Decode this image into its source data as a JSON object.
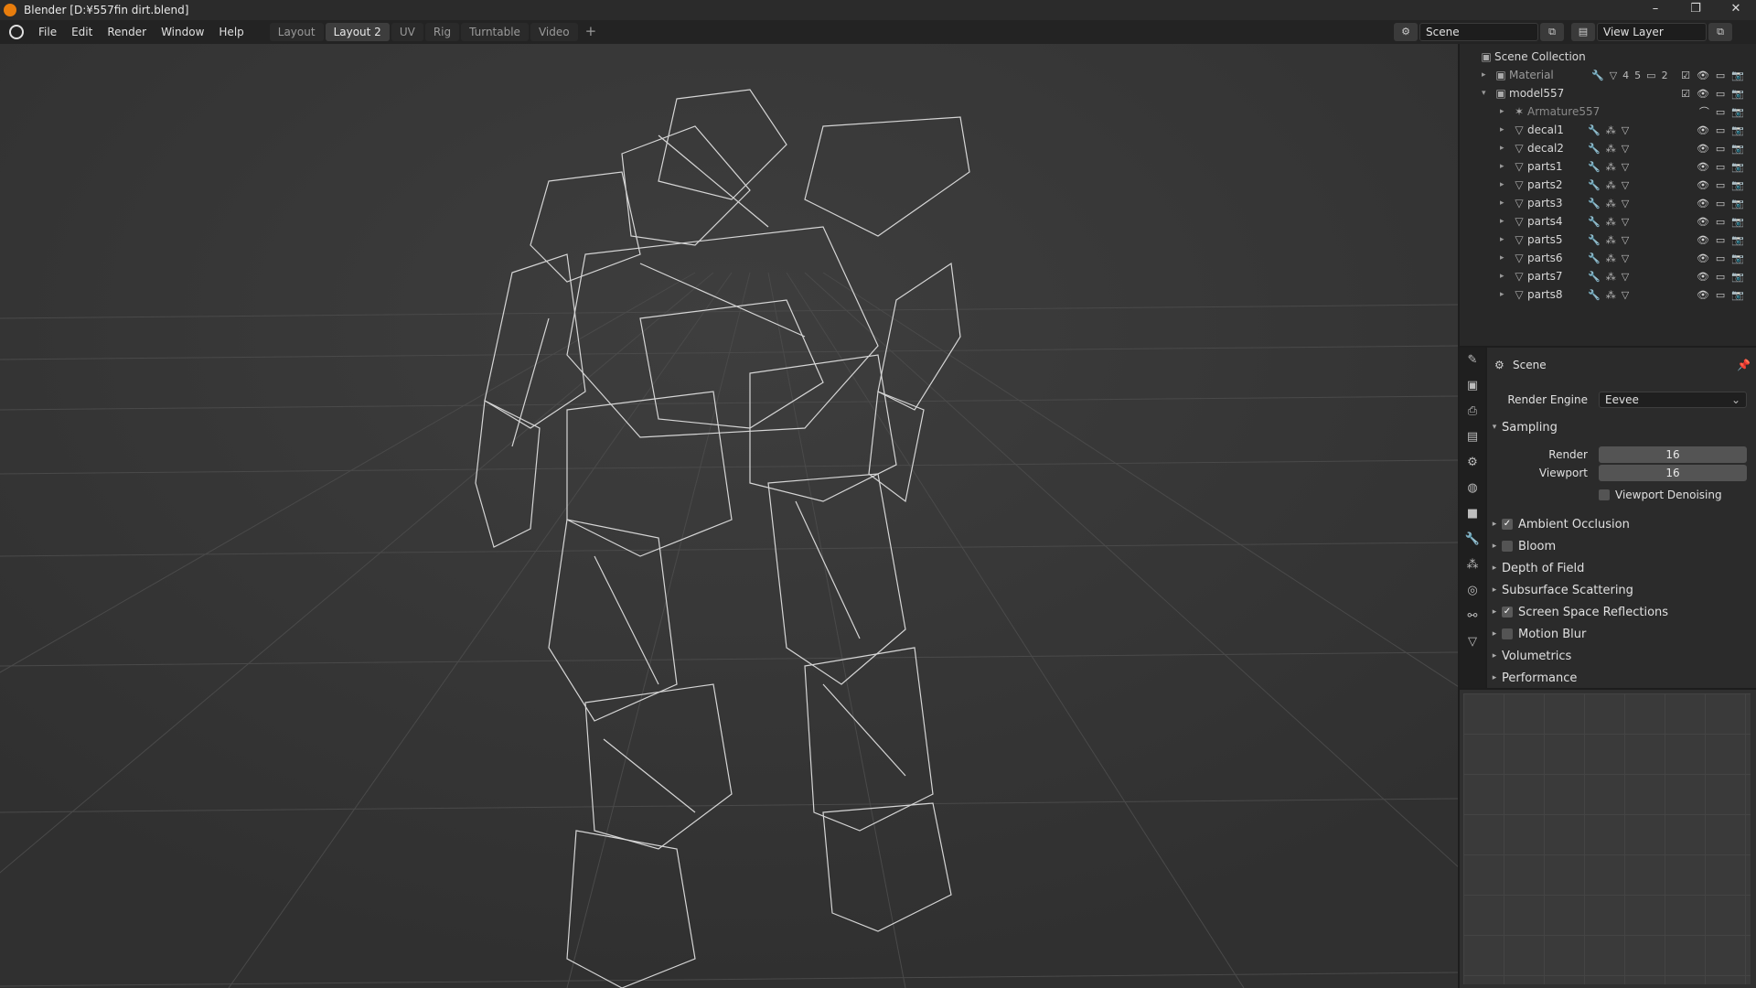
{
  "titlebar": {
    "title": "Blender [D:¥557fin dirt.blend]",
    "minimize": "–",
    "restore": "❐",
    "close": "✕"
  },
  "menubar": {
    "menus": [
      "File",
      "Edit",
      "Render",
      "Window",
      "Help"
    ],
    "workspaces": [
      "Layout",
      "Layout 2",
      "UV",
      "Rig",
      "Turntable",
      "Video"
    ],
    "active_workspace": "Layout 2",
    "add": "+",
    "scene": "Scene",
    "view_layer": "View Layer"
  },
  "outliner": {
    "root": "Scene Collection",
    "collections": [
      {
        "name": "Material",
        "count1": "45",
        "count2": "2"
      },
      {
        "name": "model557"
      }
    ],
    "objects": [
      "Armature557",
      "decal1",
      "decal2",
      "parts1",
      "parts2",
      "parts3",
      "parts4",
      "parts5",
      "parts6",
      "parts7",
      "parts8"
    ]
  },
  "properties": {
    "context": "Scene",
    "render_engine_label": "Render Engine",
    "render_engine": "Eevee",
    "sampling": "Sampling",
    "render_label": "Render",
    "render_value": "16",
    "viewport_label": "Viewport",
    "viewport_value": "16",
    "viewport_denoising": "Viewport Denoising",
    "sections": [
      {
        "name": "Ambient Occlusion",
        "checkbox": true,
        "checked": true
      },
      {
        "name": "Bloom",
        "checkbox": true,
        "checked": false
      },
      {
        "name": "Depth of Field",
        "checkbox": false
      },
      {
        "name": "Subsurface Scattering",
        "checkbox": false
      },
      {
        "name": "Screen Space Reflections",
        "checkbox": true,
        "checked": true
      },
      {
        "name": "Motion Blur",
        "checkbox": true,
        "checked": false
      },
      {
        "name": "Volumetrics",
        "checkbox": false
      },
      {
        "name": "Performance",
        "checkbox": false
      }
    ]
  },
  "colors": {
    "accent": "#e87d0d",
    "viewport_bg": "#393939",
    "panel_bg": "#2b2b2b"
  }
}
